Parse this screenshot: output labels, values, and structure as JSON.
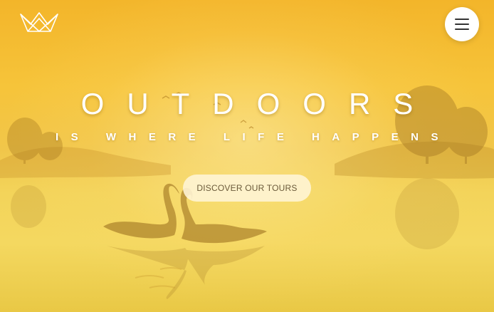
{
  "header": {
    "logo_icon": "crown-icon",
    "menu_icon": "hamburger-icon"
  },
  "hero": {
    "title": "OUTDOORS",
    "subtitle": "IS WHERE LIFE HAPPENS",
    "cta_label": "DISCOVER OUR TOURS"
  },
  "colors": {
    "background_top": "#f3b52a",
    "background_bottom": "#f4d860",
    "text": "#ffffff",
    "cta_background": "#fff5d7",
    "cta_text": "#6b5a3a"
  }
}
